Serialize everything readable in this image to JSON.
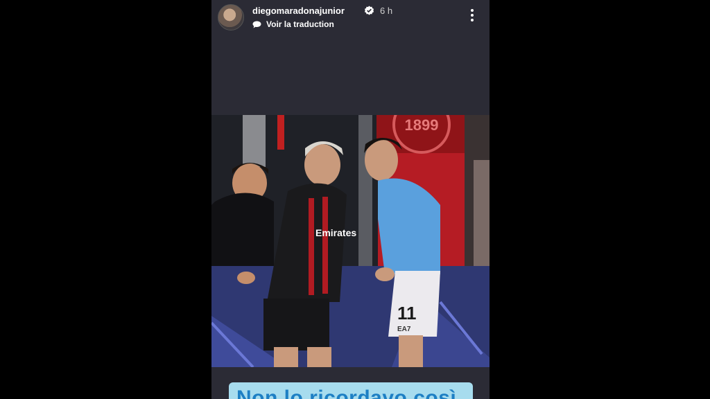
{
  "story": {
    "username": "diegomaradonajunior",
    "time": "6 h",
    "translate_label": "Voir la traduction",
    "caption": "Non lo ricordavo così"
  },
  "photo": {
    "sign_year": "1899",
    "jersey_number": "11",
    "jersey_sponsor_blue": "EA7",
    "jersey_sponsor_red": "Emirates"
  },
  "icons": {
    "verified": "verified-badge-icon",
    "translate": "speech-bubble-icon",
    "more": "more-vertical-icon"
  },
  "colors": {
    "background": "#000000",
    "story_bg": "#2b2b35",
    "caption_bg": "#a7dcee",
    "caption_text": "#1d7fc4"
  }
}
